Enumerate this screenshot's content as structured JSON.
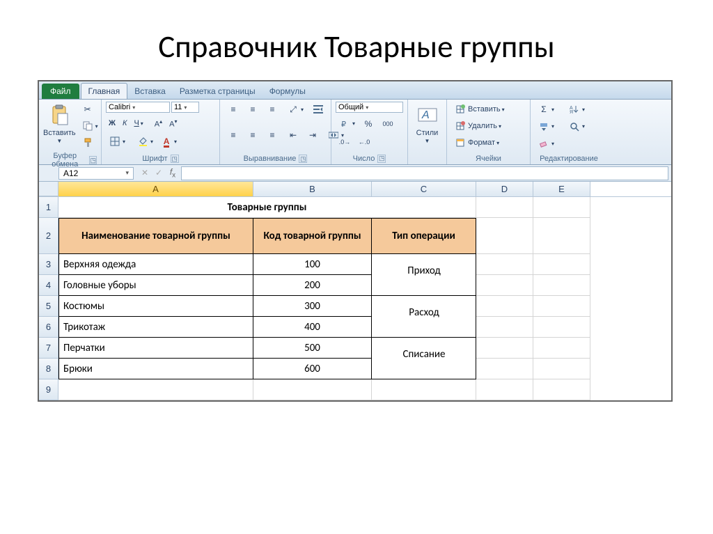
{
  "slide": {
    "title": "Справочник Товарные группы"
  },
  "tabs": {
    "file": "Файл",
    "home": "Главная",
    "insert": "Вставка",
    "layout": "Разметка страницы",
    "formulas": "Формулы"
  },
  "ribbon": {
    "clipboard": {
      "paste": "Вставить",
      "label": "Буфер обмена"
    },
    "font": {
      "name": "Calibri",
      "size": "11",
      "bold": "Ж",
      "italic": "К",
      "underline": "Ч",
      "label": "Шрифт"
    },
    "alignment": {
      "label": "Выравнивание"
    },
    "number": {
      "format": "Общий",
      "label": "Число"
    },
    "styles": {
      "label": "Стили"
    },
    "cells": {
      "insert": "Вставить",
      "delete": "Удалить",
      "format": "Формат",
      "label": "Ячейки"
    },
    "editing": {
      "label": "Редактирование"
    }
  },
  "namebox": "A12",
  "columns": [
    "A",
    "B",
    "C",
    "D",
    "E"
  ],
  "rows": [
    "1",
    "2",
    "3",
    "4",
    "5",
    "6",
    "7",
    "8",
    "9"
  ],
  "table": {
    "title": "Товарные группы",
    "hdr_name": "Наименование товарной группы",
    "hdr_code": "Код товарной группы",
    "hdr_op": "Тип операции",
    "r3_name": "Верхняя одежда",
    "r3_code": "100",
    "r4_name": "Головные уборы",
    "r4_code": "200",
    "r5_name": "Костюмы",
    "r5_code": "300",
    "r6_name": "Трикотаж",
    "r6_code": "400",
    "r7_name": "Перчатки",
    "r7_code": "500",
    "r8_name": "Брюки",
    "r8_code": "600",
    "op1": "Приход",
    "op2": "Расход",
    "op3": "Списание"
  }
}
